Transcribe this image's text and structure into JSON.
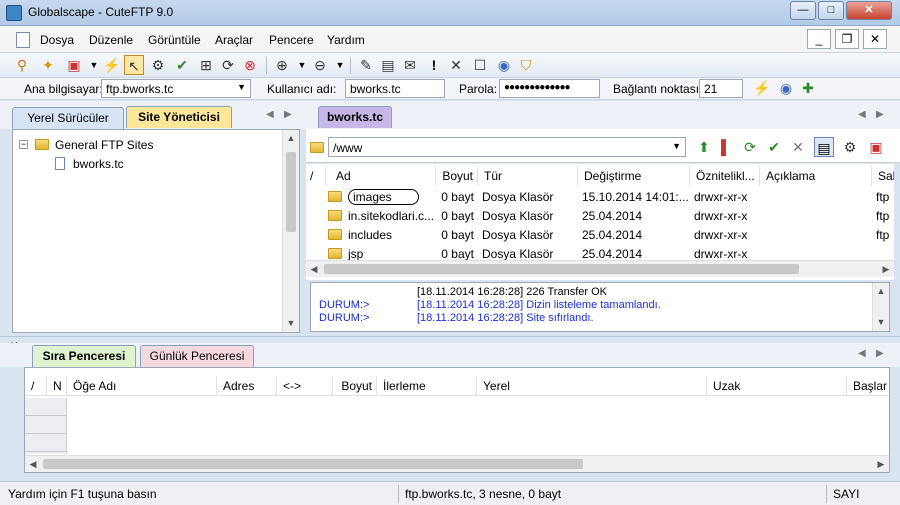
{
  "window": {
    "title": "Globalscape - CuteFTP 9.0",
    "minimize": "—",
    "maximize": "□",
    "close": "✕"
  },
  "menu": {
    "items": [
      "Dosya",
      "Düzenle",
      "Görüntüle",
      "Araçlar",
      "Pencere",
      "Yardım"
    ],
    "mdi_minimize": "_",
    "mdi_restore": "❐",
    "mdi_close": "✕"
  },
  "connection": {
    "host_label": "Ana bilgisayar:",
    "host_value": "ftp.bworks.tc",
    "user_label": "Kullanıcı adı:",
    "user_value": "bworks.tc",
    "pass_label": "Parola:",
    "pass_value": "●●●●●●●●●●●●●",
    "port_label": "Bağlantı noktası:",
    "port_value": "21"
  },
  "left_pane": {
    "tabs": [
      "Yerel Sürücüler",
      "Site Yöneticisi"
    ],
    "active_tab": "Site Yöneticisi",
    "tree": {
      "root": "General FTP Sites",
      "child": "bworks.tc",
      "root_toggle": "−"
    }
  },
  "right_pane": {
    "tab": "bworks.tc",
    "path": "/www",
    "columns": [
      "/",
      "Ad",
      "Boyut",
      "Tür",
      "Değiştirme",
      "Öznitelikl...",
      "Açıklama",
      "Sah"
    ],
    "rows": [
      {
        "name": "images",
        "size": "0 bayt",
        "type": "Dosya Klasör",
        "modified": "15.10.2014 14:01:...",
        "attrs": "drwxr-xr-x",
        "owner": "ftp"
      },
      {
        "name": "in.sitekodlari.c...",
        "size": "0 bayt",
        "type": "Dosya Klasör",
        "modified": "25.04.2014",
        "attrs": "drwxr-xr-x",
        "owner": "ftp"
      },
      {
        "name": "includes",
        "size": "0 bayt",
        "type": "Dosya Klasör",
        "modified": "25.04.2014",
        "attrs": "drwxr-xr-x",
        "owner": "ftp"
      },
      {
        "name": "jsp",
        "size": "0 bayt",
        "type": "Dosya Klasör",
        "modified": "25.04.2014",
        "attrs": "drwxr-xr-x",
        "owner": ""
      }
    ]
  },
  "log": {
    "lines": [
      {
        "prefix": "",
        "text": "[18.11.2014 16:28:28] 226 Transfer OK",
        "color": "#000000"
      },
      {
        "prefix": "DURUM:>",
        "text": "[18.11.2014 16:28:28] Dizin listeleme tamamlandı.",
        "color": "#1a2fd6"
      },
      {
        "prefix": "DURUM:>",
        "text": "[18.11.2014 16:28:28] Site sıfırlandı.",
        "color": "#1a2fd6"
      }
    ]
  },
  "queue": {
    "tabs": [
      "Sıra Penceresi",
      "Günlük Penceresi"
    ],
    "close": "×",
    "columns": [
      "/",
      "N",
      "Öğe Adı",
      "Adres",
      "<->",
      "Boyut",
      "İlerleme",
      "Yerel",
      "Uzak",
      "Başlar"
    ]
  },
  "status": {
    "help": "Yardım için F1 tuşuna basın",
    "summary": "ftp.bworks.tc, 3 nesne, 0 bayt",
    "num": "SAYI"
  },
  "colors": {
    "left_active_tab": "#fbe69a",
    "right_tab": "#c7b7e8",
    "queue_tab": "#dff3cf",
    "log_tab": "#f6d9de",
    "log_blue": "#1a2fd6"
  }
}
